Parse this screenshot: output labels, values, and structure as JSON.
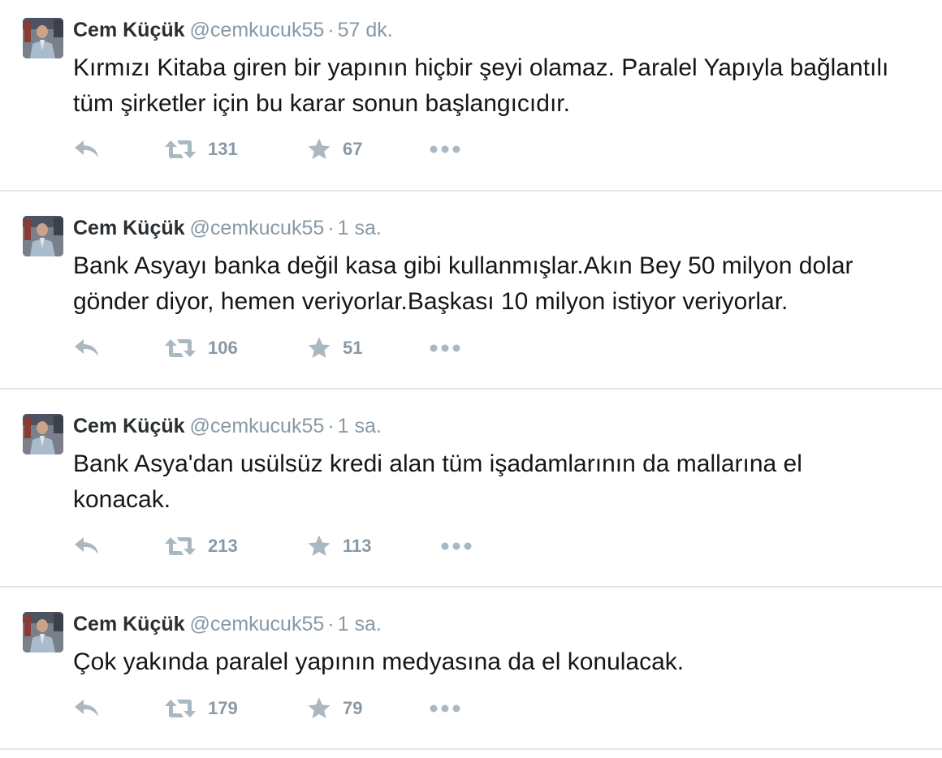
{
  "tweets": [
    {
      "name": "Cem Küçük",
      "handle": "@cemkucuk55",
      "separator": "·",
      "time": "57 dk.",
      "text": "Kırmızı Kitaba giren bir yapının hiçbir şeyi olamaz. Paralel Yapıyla bağlantılı tüm şirketler için bu karar sonun başlangıcıdır.",
      "retweets": "131",
      "favorites": "67"
    },
    {
      "name": "Cem Küçük",
      "handle": "@cemkucuk55",
      "separator": "·",
      "time": "1 sa.",
      "text": "Bank Asyayı banka değil kasa gibi kullanmışlar.Akın Bey 50 milyon dolar gönder diyor, hemen veriyorlar.Başkası 10 milyon istiyor veriyorlar.",
      "retweets": "106",
      "favorites": "51"
    },
    {
      "name": "Cem Küçük",
      "handle": "@cemkucuk55",
      "separator": "·",
      "time": "1 sa.",
      "text": "Bank Asya'dan usülsüz kredi alan tüm işadamlarının da mallarına el konacak.",
      "retweets": "213",
      "favorites": "113"
    },
    {
      "name": "Cem Küçük",
      "handle": "@cemkucuk55",
      "separator": "·",
      "time": "1 sa.",
      "text": "Çok yakında paralel yapının medyasına da el konulacak.",
      "retweets": "179",
      "favorites": "79"
    }
  ],
  "icons": {
    "reply": "reply-icon",
    "retweet": "retweet-icon",
    "favorite": "star-icon",
    "more": "more-icon"
  },
  "colors": {
    "text": "#14171a",
    "muted": "#8899a6",
    "icon": "#aab8c2",
    "divider": "#e1e8ed"
  }
}
